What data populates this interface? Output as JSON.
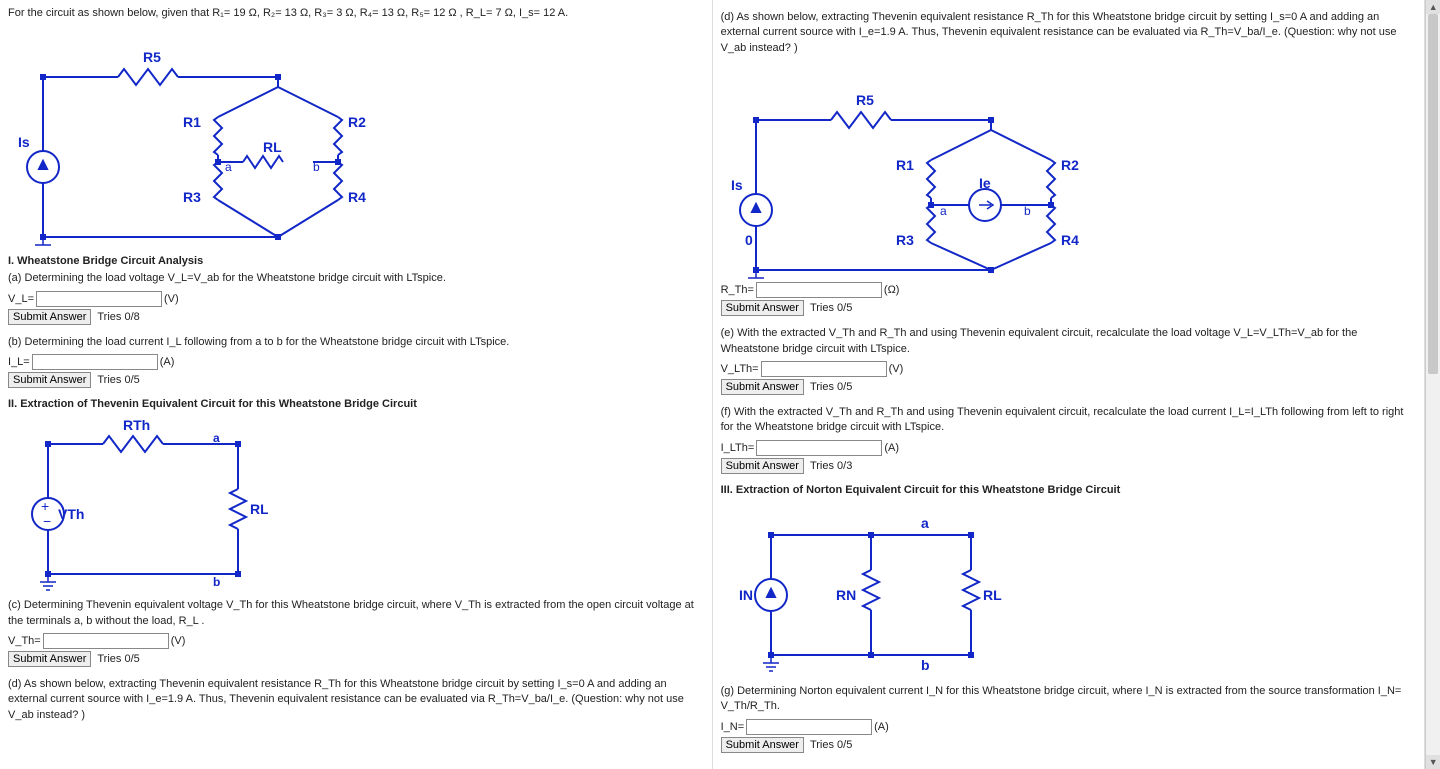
{
  "left": {
    "intro": "For the circuit as shown below, given that R₁= 19 Ω, R₂= 13 Ω, R₃= 3 Ω, R₄= 13 Ω, R₅= 12 Ω , R_L= 7 Ω, I_s= 12 A.",
    "sec1_head": "I. Wheatstone Bridge Circuit Analysis",
    "qa_text": "(a) Determining the load voltage V_L=V_ab for the Wheatstone bridge circuit with LTspice.",
    "qa_symbol": "V_L=",
    "qa_unit": "(V)",
    "qa_submit": "Submit Answer",
    "qa_tries": "Tries 0/8",
    "qb_text": "(b) Determining the load current I_L following from a to b for the Wheatstone bridge circuit with LTspice.",
    "qb_symbol": "I_L=",
    "qb_unit": "(A)",
    "qb_submit": "Submit Answer",
    "qb_tries": "Tries 0/5",
    "sec2_head": "II. Extraction of Thevenin Equivalent Circuit for this Wheatstone Bridge Circuit",
    "qc_text": "(c) Determining Thevenin equivalent voltage V_Th for this Wheatstone bridge circuit, where V_Th is extracted from the open circuit voltage at the terminals a, b without the load, R_L .",
    "qc_symbol": "V_Th=",
    "qc_unit": "(V)",
    "qc_submit": "Submit Answer",
    "qc_tries": "Tries 0/5",
    "qd_text": "(d) As shown below, extracting Thevenin equivalent resistance R_Th for this Wheatstone bridge circuit by setting I_s=0 A and adding an external current source with I_e=1.9 A. Thus, Thevenin equivalent resistance can be evaluated via R_Th=V_ba/I_e. (Question: why not use V_ab instead? )"
  },
  "right": {
    "qd_text": "(d) As shown below, extracting Thevenin equivalent resistance R_Th for this Wheatstone bridge circuit by setting I_s=0 A and adding an external current source with I_e=1.9 A. Thus, Thevenin equivalent resistance can be evaluated via R_Th=V_ba/I_e. (Question: why not use V_ab instead? )",
    "qd_symbol": "R_Th=",
    "qd_unit": "(Ω)",
    "qd_submit": "Submit Answer",
    "qd_tries": "Tries 0/5",
    "qe_text": "(e) With the extracted V_Th and R_Th and using Thevenin equivalent circuit, recalculate the load voltage V_L=V_LTh=V_ab for the Wheatstone bridge circuit with LTspice.",
    "qe_symbol": "V_LTh=",
    "qe_unit": "(V)",
    "qe_submit": "Submit Answer",
    "qe_tries": "Tries 0/5",
    "qf_text": "(f) With the extracted V_Th and R_Th and using Thevenin equivalent circuit, recalculate the load current I_L=I_LTh following from left to right for the Wheatstone bridge circuit with LTspice.",
    "qf_symbol": "I_LTh=",
    "qf_unit": "(A)",
    "qf_submit": "Submit Answer",
    "qf_tries": "Tries 0/3",
    "sec3_head": "III. Extraction of Norton Equivalent Circuit for this Wheatstone Bridge Circuit",
    "qg_text": "(g) Determining Norton equivalent current I_N for this Wheatstone bridge circuit, where I_N is extracted from the source transformation I_N= V_Th/R_Th.",
    "qg_symbol": "I_N=",
    "qg_unit": "(A)",
    "qg_submit": "Submit Answer",
    "qg_tries": "Tries 0/5"
  },
  "labels": {
    "R5": "R5",
    "R1": "R1",
    "R2": "R2",
    "R3": "R3",
    "R4": "R4",
    "RL": "RL",
    "Is": "Is",
    "Ie": "Ie",
    "a": "a",
    "b": "b",
    "RTh": "RTh",
    "VTh": "VTh",
    "IN": "IN",
    "RN": "RN",
    "zero": "0"
  }
}
